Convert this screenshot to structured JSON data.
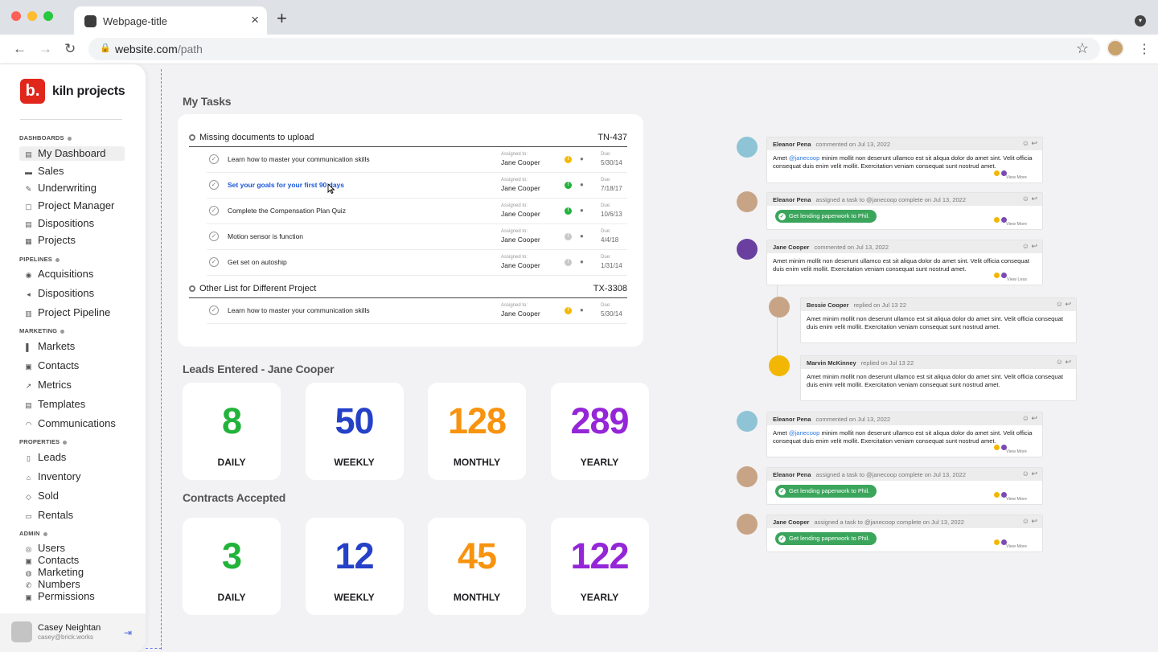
{
  "browser": {
    "tab_title": "Webpage-title",
    "url_host": "website.com",
    "url_path": "/path"
  },
  "sidebar": {
    "brand_logo": "b.",
    "brand_name": "kiln projects",
    "sections": {
      "dashboards": "DASHBOARDS",
      "pipelines": "PIPELINES",
      "marketing": "MARKETING",
      "properties": "PROPERTIES",
      "admin": "ADMIN"
    },
    "dashboards": [
      "My Dashboard",
      "Sales",
      "Underwriting",
      "Project Manager",
      "Dispositions",
      "Projects"
    ],
    "pipelines": [
      "Acquisitions",
      "Dispositions",
      "Project Pipeline"
    ],
    "marketing": [
      "Markets",
      "Contacts",
      "Metrics",
      "Templates",
      "Communications"
    ],
    "properties": [
      "Leads",
      "Inventory",
      "Sold",
      "Rentals"
    ],
    "admin": [
      "Users",
      "Contacts",
      "Marketing",
      "Numbers",
      "Permissions"
    ],
    "user": {
      "name": "Casey Neightan",
      "email": "casey@brick.works"
    }
  },
  "tasks": {
    "title": "My Tasks",
    "assigned_label": "Assigned to:",
    "due_label": "Due:",
    "groups": [
      {
        "name": "Missing documents to upload",
        "code": "TN-437",
        "items": [
          {
            "name": "Learn how to master your communication skills",
            "assignee": "Jane Cooper",
            "due": "5/30/14",
            "priority_color": "#f5b800"
          },
          {
            "name": "Set your goals for your first 90 days",
            "assignee": "Jane Cooper",
            "due": "7/18/17",
            "priority_color": "#22b33a"
          },
          {
            "name": "Complete the Compensation Plan Quiz",
            "assignee": "Jane Cooper",
            "due": "10/6/13",
            "priority_color": "#22b33a"
          },
          {
            "name": "Motion sensor is function",
            "assignee": "Jane Cooper",
            "due": "4/4/18",
            "priority_color": "#c8c8c8"
          },
          {
            "name": "Get set on autoship",
            "assignee": "Jane Cooper",
            "due": "1/31/14",
            "priority_color": "#c8c8c8"
          }
        ]
      },
      {
        "name": "Other List for Different Project",
        "code": "TX-3308",
        "items": [
          {
            "name": "Learn how to master your communication skills",
            "assignee": "Jane Cooper",
            "due": "5/30/14",
            "priority_color": "#f5b800"
          }
        ]
      }
    ]
  },
  "leads": {
    "title": "Leads Entered - Jane Cooper",
    "stats": [
      {
        "value": "8",
        "label": "DAILY",
        "color": "#22b33a"
      },
      {
        "value": "50",
        "label": "WEEKLY",
        "color": "#2541c8"
      },
      {
        "value": "128",
        "label": "MONTHLY",
        "color": "#f7930e"
      },
      {
        "value": "289",
        "label": "YEARLY",
        "color": "#9426d8"
      }
    ]
  },
  "contracts": {
    "title": "Contracts Accepted",
    "stats": [
      {
        "value": "3",
        "label": "DAILY",
        "color": "#22b33a"
      },
      {
        "value": "12",
        "label": "WEEKLY",
        "color": "#2541c8"
      },
      {
        "value": "45",
        "label": "MONTHLY",
        "color": "#f7930e"
      },
      {
        "value": "122",
        "label": "YEARLY",
        "color": "#9426d8"
      }
    ]
  },
  "feed": [
    {
      "author": "Eleanor Pena",
      "action": "commented on Jul 13, 2022",
      "pre": "Amet ",
      "mention": "@janecoop",
      "text": " minim mollit non deserunt ullamco est sit aliqua dolor do amet sint. Velit officia consequat duis enim velit mollit. Exercitation veniam consequat sunt nostrud amet.",
      "more": "View More"
    },
    {
      "author": "Eleanor Pena",
      "action": "assigned a task to @janecoop complete on Jul 13, 2022",
      "pill": "Get lending paperwork to Phil.",
      "more": "View More"
    },
    {
      "author": "Jane Cooper",
      "action": "commented on Jul 13, 2022",
      "text": "Amet minim mollit non deserunt ullamco est sit aliqua dolor do amet sint. Velit officia consequat duis enim velit mollit. Exercitation veniam consequat sunt nostrud amet.",
      "more": "View Less"
    },
    {
      "author": "Bessie Cooper",
      "action": "replied on Jul 13 22",
      "text": "Amet minim mollit non deserunt ullamco est sit aliqua dolor do amet sint. Velit officia consequat duis enim velit mollit. Exercitation veniam consequat sunt nostrud amet."
    },
    {
      "author": "Marvin McKinney",
      "action": "replied on Jul 13 22",
      "text": "Amet minim mollit non deserunt ullamco est sit aliqua dolor do amet sint. Velit officia consequat duis enim velit mollit. Exercitation veniam consequat sunt nostrud amet."
    },
    {
      "author": "Eleanor Pena",
      "action": "commented on Jul 13, 2022",
      "pre": "Amet ",
      "mention": "@janecoop",
      "text": " minim mollit non deserunt ullamco est sit aliqua dolor do amet sint. Velit officia consequat duis enim velit mollit. Exercitation veniam consequat sunt nostrud amet.",
      "more": "View More"
    },
    {
      "author": "Eleanor Pena",
      "action": "assigned a task to @janecoop complete on Jul 13, 2022",
      "pill": "Get lending paperwork to Phil.",
      "more": "View More"
    },
    {
      "author": "Jane Cooper",
      "action": "assigned a task to @janecoop complete on Jul 13, 2022",
      "pill": "Get lending paperwork to Phil.",
      "more": "View More"
    }
  ]
}
